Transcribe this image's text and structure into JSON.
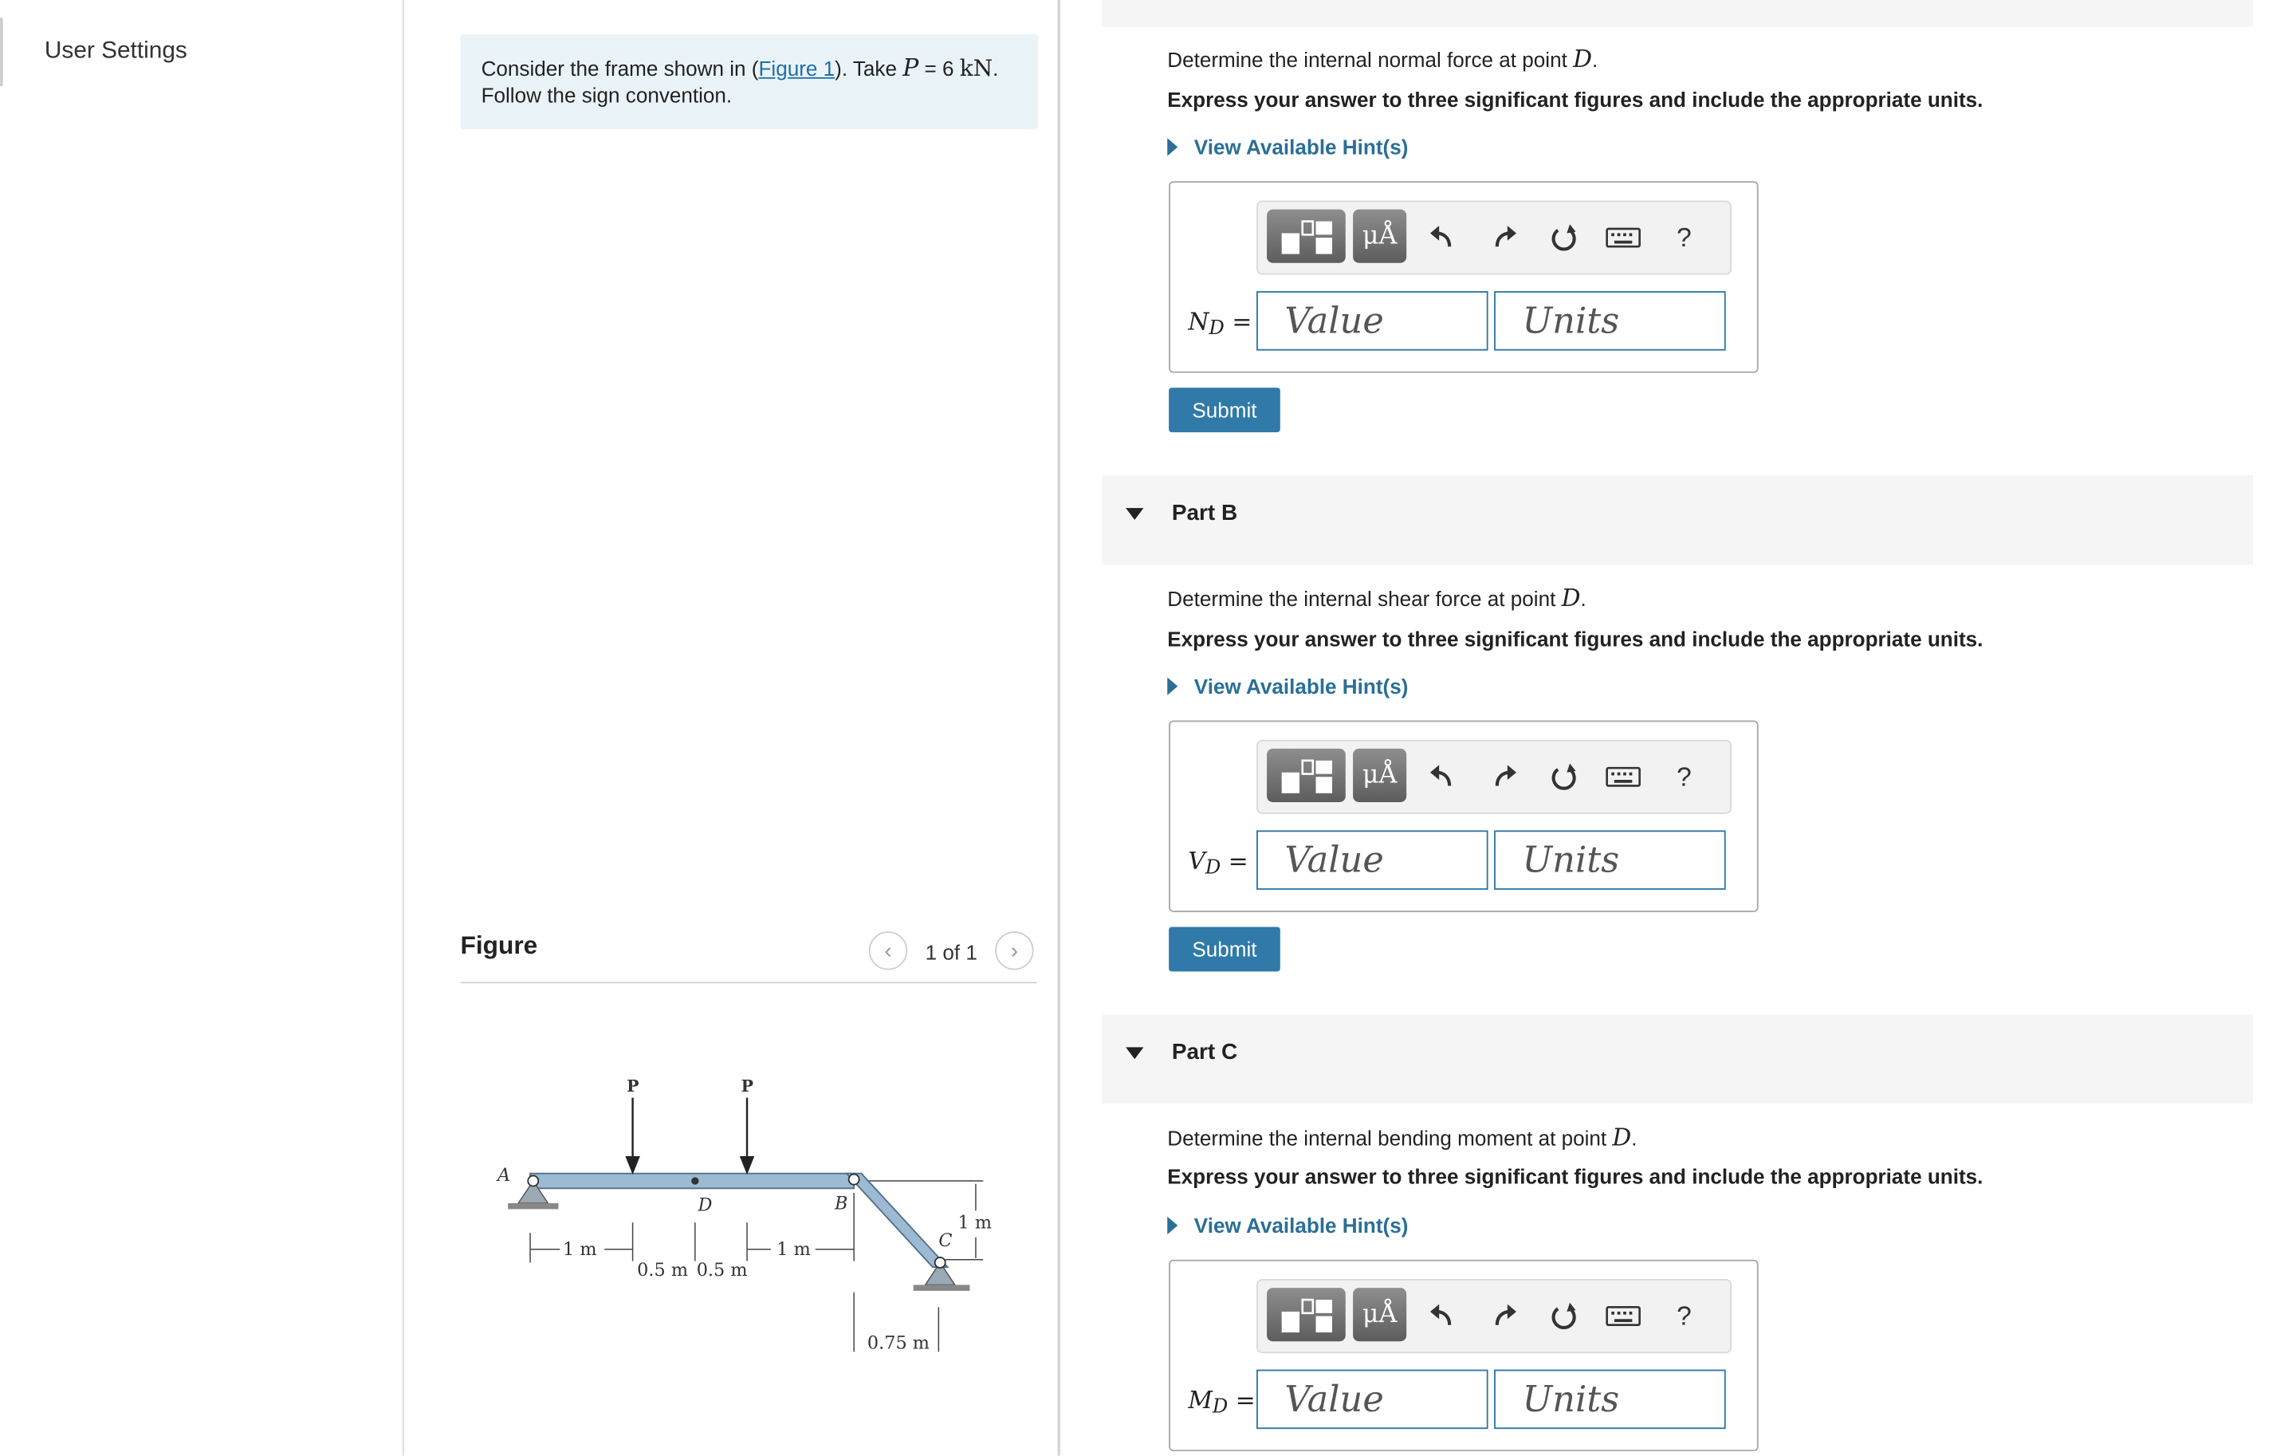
{
  "nav": {
    "user_settings": "User Settings"
  },
  "problem": {
    "intro_before": "Consider the frame shown in (",
    "intro_link": "Figure 1",
    "intro_after": "). Take ",
    "p_symbol": "P",
    "equals": " = 6 ",
    "unit": "kN",
    "intro_end": ".",
    "intro_line2": "Follow the sign convention."
  },
  "figure": {
    "title": "Figure",
    "pager": "1 of 1",
    "labels": {
      "p1": "P",
      "p2": "P",
      "a": "A",
      "d": "D",
      "b": "B",
      "c": "C",
      "dim1": "1 m",
      "dim2": "0.5 m",
      "dim3": "0.5 m",
      "dim4": "1 m",
      "dim_height": "1 m",
      "dim_horizontal": "0.75 m"
    }
  },
  "parts": [
    {
      "id": "A",
      "question_prefix": "Determine the internal normal force at point ",
      "point": "D",
      "question_suffix": ".",
      "instruction": "Express your answer to three significant figures and include the appropriate units.",
      "hint": "View Available Hint(s)",
      "var_symbol": "N",
      "var_sub": "D",
      "var_eq": " =",
      "value_placeholder": "Value",
      "units_placeholder": "Units",
      "submit": "Submit"
    },
    {
      "id": "B",
      "title": "Part B",
      "question_prefix": "Determine the internal shear force at point ",
      "point": "D",
      "question_suffix": ".",
      "instruction": "Express your answer to three significant figures and include the appropriate units.",
      "hint": "View Available Hint(s)",
      "var_symbol": "V",
      "var_sub": "D",
      "var_eq": " =",
      "value_placeholder": "Value",
      "units_placeholder": "Units",
      "submit": "Submit"
    },
    {
      "id": "C",
      "title": "Part C",
      "question_prefix": "Determine the internal bending moment at point ",
      "point": "D",
      "question_suffix": ".",
      "instruction": "Express your answer to three significant figures and include the appropriate units.",
      "hint": "View Available Hint(s)",
      "var_symbol": "M",
      "var_sub": "D",
      "var_eq": " =",
      "value_placeholder": "Value",
      "units_placeholder": "Units"
    }
  ],
  "toolbar": {
    "mu_label": "μÅ",
    "help_label": "?"
  },
  "icons": {
    "templates": "templates-icon",
    "units": "mu-angstrom-icon",
    "undo": "undo-icon",
    "redo": "redo-icon",
    "reset": "reset-icon",
    "keyboard": "keyboard-icon",
    "help": "help-icon"
  },
  "colors": {
    "accent": "#2f7aa8",
    "link": "#2a6f97",
    "intro_bg": "#eaf4f8",
    "beam": "#9dbad3"
  }
}
